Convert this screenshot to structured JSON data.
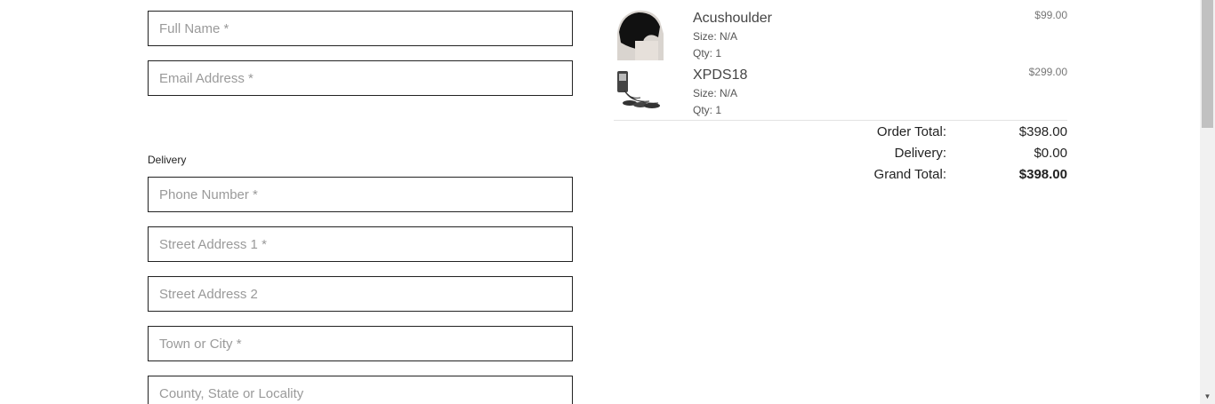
{
  "form": {
    "full_name_placeholder": "Full Name *",
    "email_placeholder": "Email Address *",
    "delivery_label": "Delivery",
    "phone_placeholder": "Phone Number *",
    "street1_placeholder": "Street Address 1 *",
    "street2_placeholder": "Street Address 2",
    "town_placeholder": "Town or City *",
    "county_placeholder": "County, State or Locality"
  },
  "cart": {
    "items": [
      {
        "name": "Acushoulder",
        "size": "Size: N/A",
        "qty": "Qty: 1",
        "price": "$99.00",
        "thumb_icon": "shoulder-brace-image"
      },
      {
        "name": "XPDS18",
        "size": "Size: N/A",
        "qty": "Qty: 1",
        "price": "$299.00",
        "thumb_icon": "tens-device-image"
      }
    ],
    "totals": {
      "order_total_label": "Order Total:",
      "order_total_value": "$398.00",
      "delivery_label": "Delivery:",
      "delivery_value": "$0.00",
      "grand_total_label": "Grand Total:",
      "grand_total_value": "$398.00"
    }
  },
  "scrollbar": {
    "down_arrow_icon": "chevron-down-icon"
  }
}
